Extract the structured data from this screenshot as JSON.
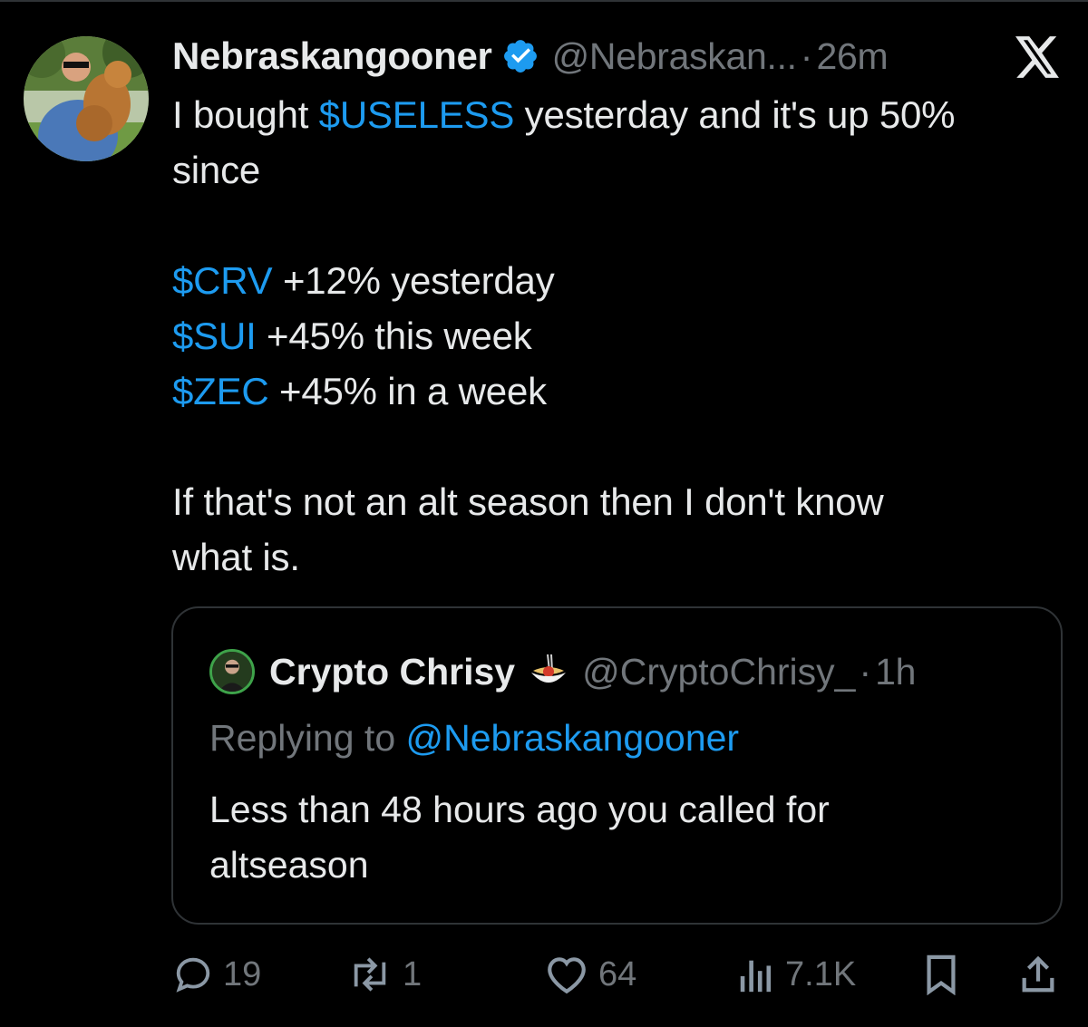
{
  "tweet": {
    "display_name": "Nebraskangooner",
    "handle": "@Nebraskan...",
    "separator": "·",
    "time": "26m",
    "line1_prefix": "I bought ",
    "line1_cashtag": "$USELESS",
    "line1_suffix": " yesterday and it's up 50%",
    "line2": "since",
    "items": [
      {
        "cashtag": "$CRV",
        "text": " +12% yesterday"
      },
      {
        "cashtag": "$SUI",
        "text": " +45% this week"
      },
      {
        "cashtag": "$ZEC",
        "text": " +45% in a week"
      }
    ],
    "closing_line1": "If that's not an alt season then I don't know",
    "closing_line2": "what is."
  },
  "quote": {
    "display_name": "Crypto Chrisy",
    "emoji": "spaghetti-emoji",
    "handle": "@CryptoChrisy_",
    "separator": "·",
    "time": "1h",
    "replying_prefix": "Replying to ",
    "replying_handle": "@Nebraskangooner",
    "text_line1": "Less than 48 hours ago you called for",
    "text_line2": "altseason"
  },
  "actions": {
    "replies": "19",
    "reposts": "1",
    "likes": "64",
    "views": "7.1K"
  },
  "colors": {
    "background": "#000000",
    "text": "#e7e9ea",
    "secondary": "#71767b",
    "link": "#1d9bf0",
    "verified": "#1d9bf0"
  }
}
